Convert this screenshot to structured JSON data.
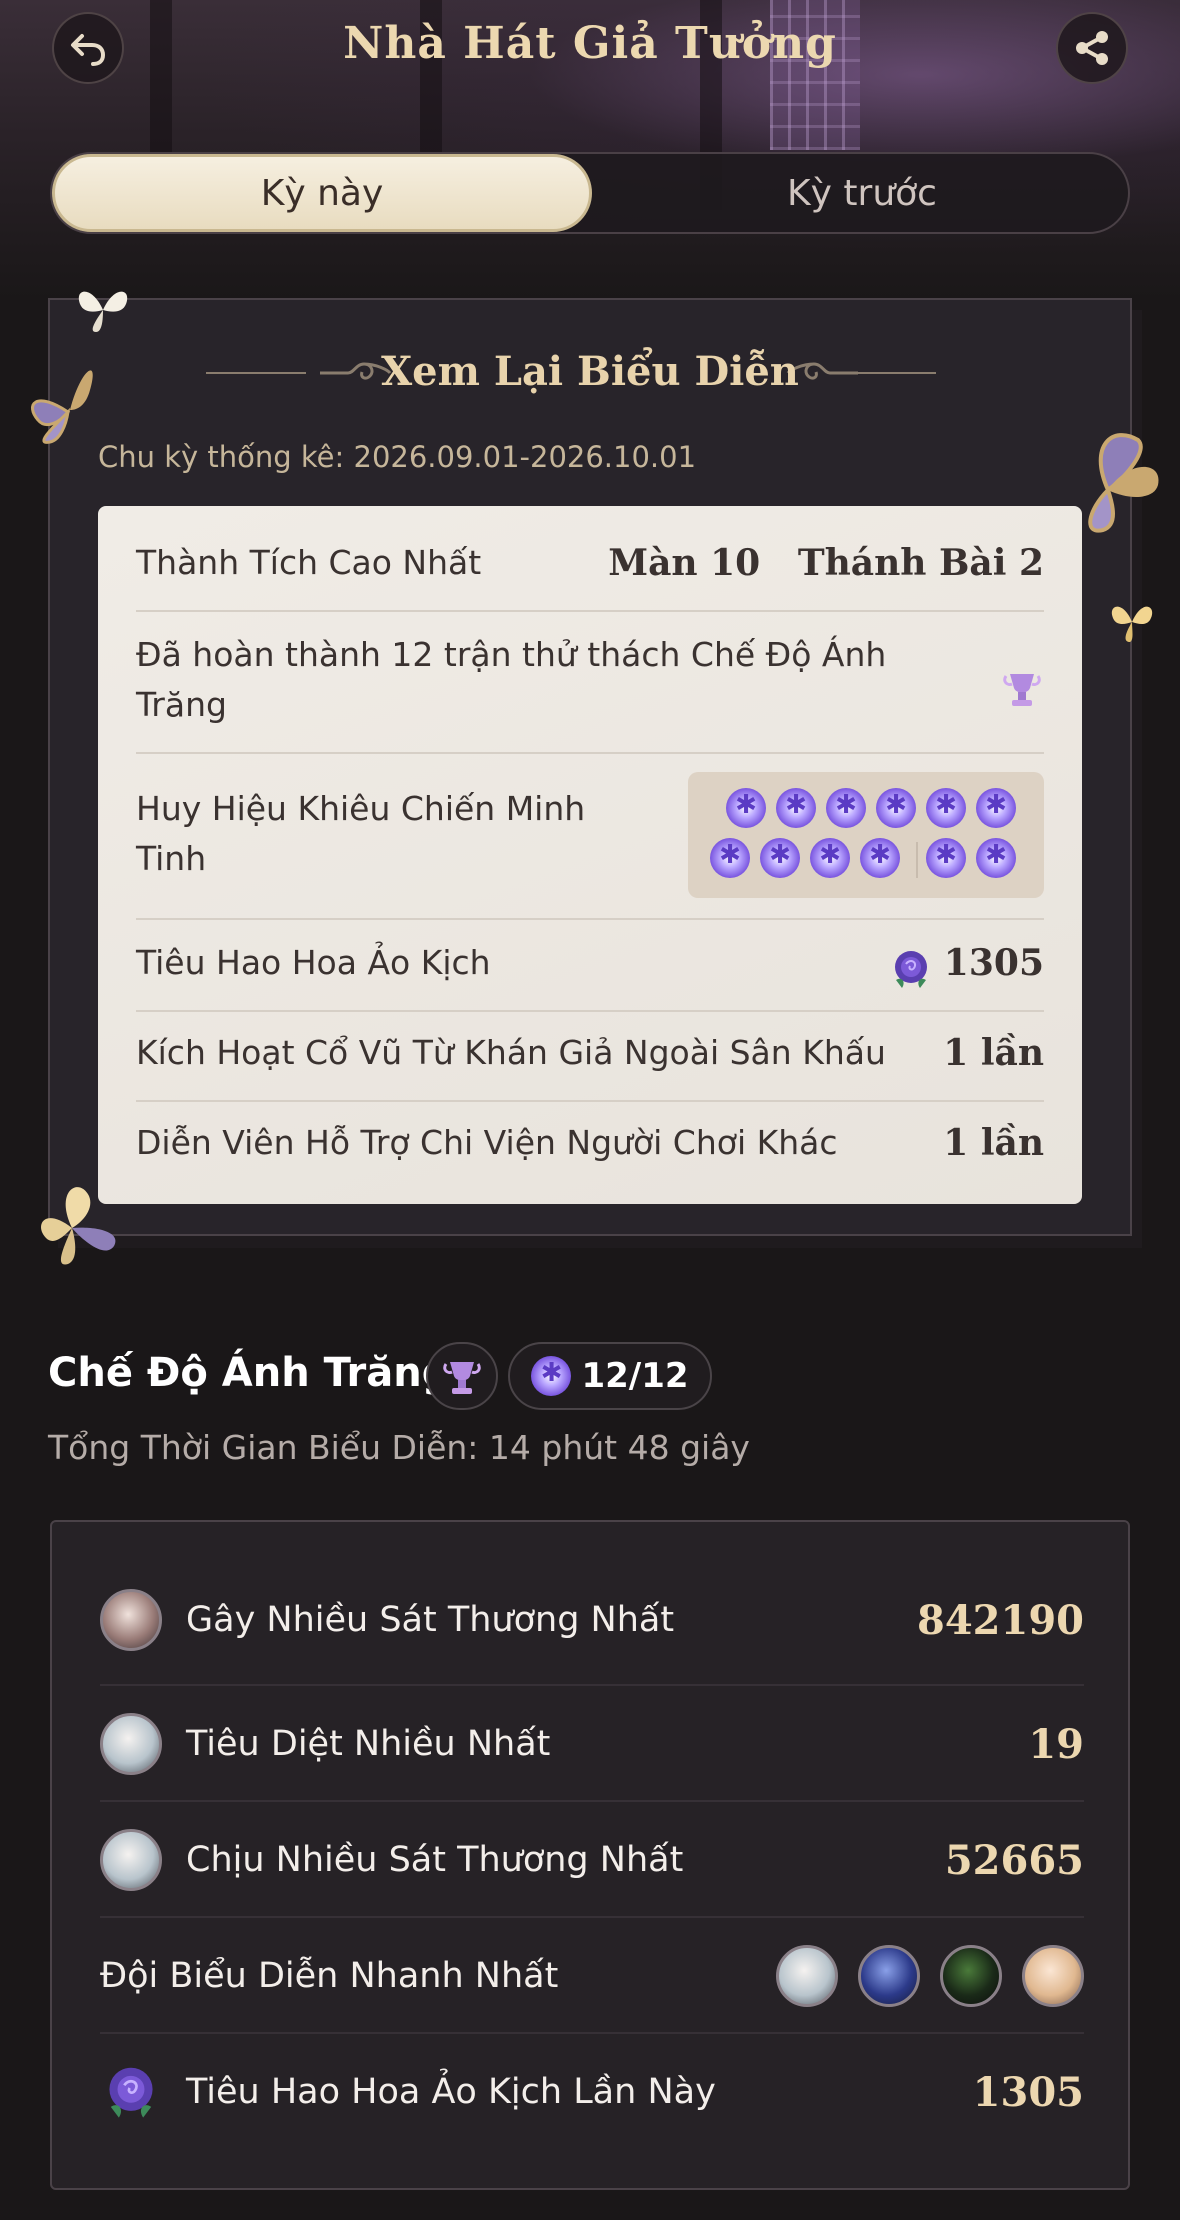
{
  "header": {
    "title": "Nhà Hát Giả Tưởng",
    "back_icon": "back-arrow-icon",
    "share_icon": "share-icon"
  },
  "tabs": [
    {
      "label": "Kỳ này",
      "active": true
    },
    {
      "label": "Kỳ trước",
      "active": false
    }
  ],
  "review": {
    "title": "Xem Lại Biểu Diễn",
    "cycle": "Chu kỳ thống kê: 2026.09.01-2026.10.01",
    "rows": {
      "best": {
        "label": "Thành Tích Cao Nhất",
        "value": "Màn 10   Thánh Bài 2"
      },
      "completed": {
        "label": "Đã hoàn thành 12 trận thử thách Chế Độ Ánh Trăng",
        "icon": "trophy-icon"
      },
      "badges": {
        "label": "Huy Hiệu Khiêu Chiến Minh Tinh",
        "count": 12
      },
      "consume": {
        "label": "Tiêu Hao Hoa Ảo Kịch",
        "value": "1305",
        "icon": "rose-icon"
      },
      "cheer": {
        "label": "Kích Hoạt Cổ Vũ Từ Khán Giả Ngoài Sân Khấu",
        "value": "1 lần"
      },
      "support": {
        "label": "Diễn Viên Hỗ Trợ Chi Viện Người Chơi Khác",
        "value": "1 lần"
      }
    }
  },
  "mode": {
    "title": "Chế Độ Ánh Trăng",
    "progress": "12/12",
    "total_time": "Tổng Thời Gian Biểu Diễn: 14 phút 48 giây"
  },
  "stats": [
    {
      "label": "Gây Nhiều Sát Thương Nhất",
      "value": "842190"
    },
    {
      "label": "Tiêu Diệt Nhiều Nhất",
      "value": "19"
    },
    {
      "label": "Chịu Nhiều Sát Thương Nhất",
      "value": "52665"
    },
    {
      "label": "Đội Biểu Diễn Nhanh Nhất",
      "team_size": 4
    },
    {
      "label": "Tiêu Hao Hoa Ảo Kịch Lần Này",
      "value": "1305"
    }
  ],
  "colors": {
    "accent_gold": "#ecd7b0",
    "badge_purple": "#7a56e0",
    "background": "#1a1718"
  }
}
